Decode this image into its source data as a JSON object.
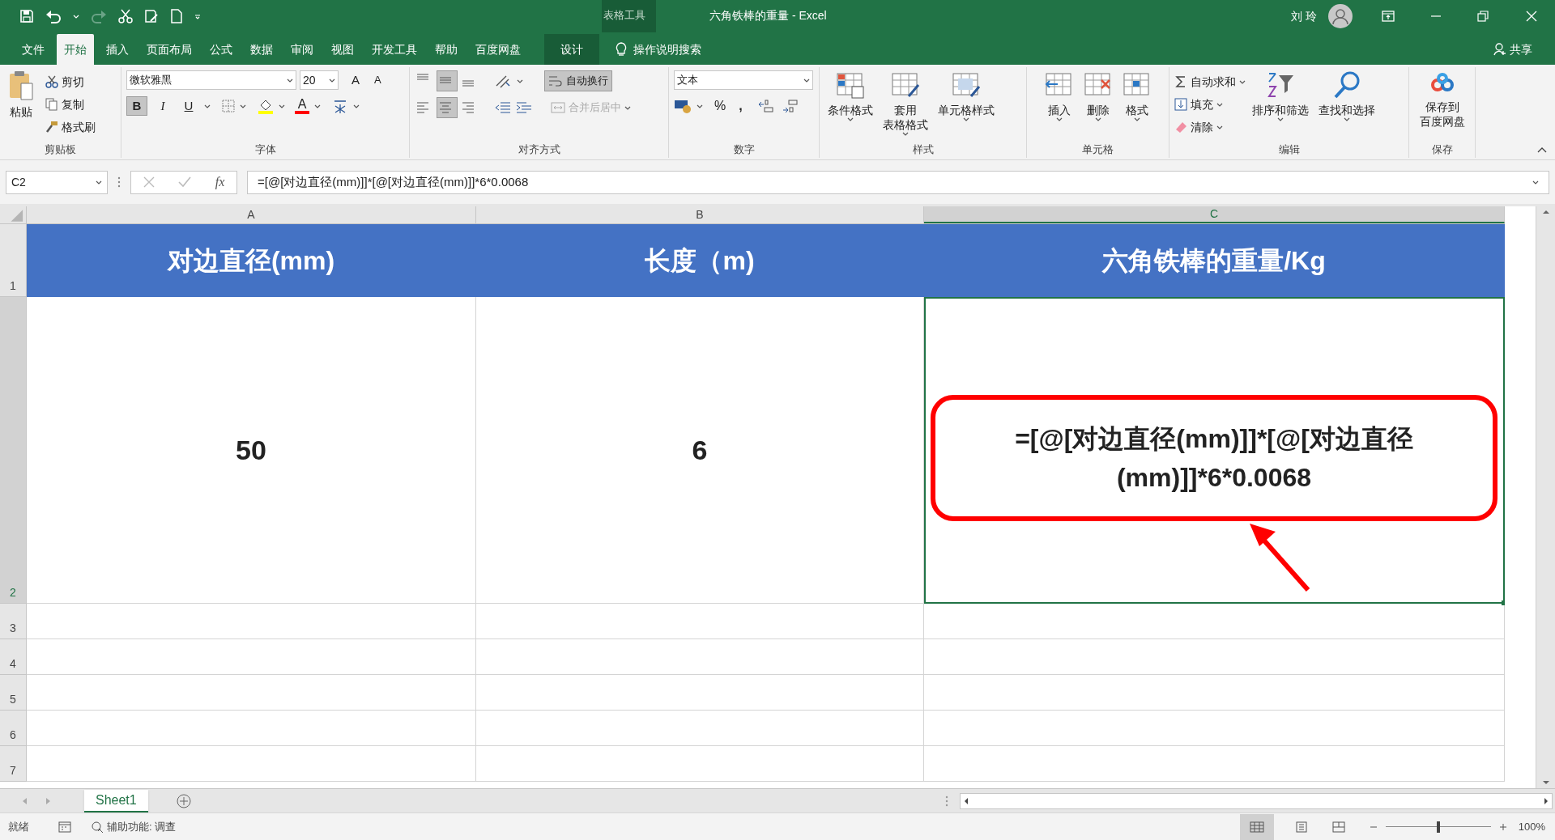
{
  "title_bar": {
    "context_label": "表格工具",
    "title": "六角铁棒的重量  -  Excel",
    "user": "刘 玲"
  },
  "tabs": [
    {
      "label": "文件",
      "selected": false
    },
    {
      "label": "开始",
      "selected": true
    },
    {
      "label": "插入",
      "selected": false
    },
    {
      "label": "页面布局",
      "selected": false
    },
    {
      "label": "公式",
      "selected": false
    },
    {
      "label": "数据",
      "selected": false
    },
    {
      "label": "审阅",
      "selected": false
    },
    {
      "label": "视图",
      "selected": false
    },
    {
      "label": "开发工具",
      "selected": false
    },
    {
      "label": "帮助",
      "selected": false
    },
    {
      "label": "百度网盘",
      "selected": false
    },
    {
      "label": "设计",
      "selected": false,
      "kind": "context"
    }
  ],
  "tell_me": "操作说明搜索",
  "share": "共享",
  "ribbon": [
    {
      "kind": "clipboard",
      "label": "剪贴板",
      "paste": "粘贴",
      "items": [
        "剪切",
        "复制",
        "格式刷"
      ]
    },
    {
      "kind": "font",
      "label": "字体",
      "font": "微软雅黑",
      "size": "20",
      "grow": "A",
      "shrink": "A",
      "toggles": [
        {
          "label": "B",
          "selected": true
        },
        {
          "label": "I",
          "selected": false
        },
        {
          "label": "U",
          "selected": false
        }
      ],
      "font_color": "A"
    },
    {
      "kind": "alignment",
      "label": "对齐方式",
      "vertical": [
        {
          "selected": false
        },
        {
          "selected": true
        },
        {
          "selected": false
        }
      ],
      "horizontal": [
        {
          "selected": false
        },
        {
          "selected": true
        },
        {
          "selected": false
        }
      ],
      "wrap": {
        "label": "自动换行",
        "selected": true
      },
      "merge": {
        "label": "合并后居中",
        "disabled": true
      }
    },
    {
      "kind": "number",
      "label": "数字",
      "format": "文本",
      "percent": "%",
      "comma": ","
    },
    {
      "kind": "styles",
      "label": "样式",
      "items": [
        [
          "条件格式"
        ],
        [
          "套用",
          "表格格式"
        ],
        [
          "单元格样式"
        ]
      ]
    },
    {
      "kind": "cells",
      "label": "单元格",
      "items": [
        "插入",
        "删除",
        "格式"
      ]
    },
    {
      "kind": "editing",
      "label": "编辑",
      "items": [
        "自动求和",
        "填充",
        "清除"
      ],
      "large": [
        "排序和筛选",
        "查找和选择"
      ]
    },
    {
      "kind": "save",
      "label": "保存",
      "items": [
        "保存到",
        "百度网盘"
      ]
    }
  ],
  "formula_bar": {
    "name_box": "C2",
    "function_label": "fx",
    "formula": "=[@[对边直径(mm)]]*[@[对边直径(mm)]]*6*0.0068"
  },
  "sheet": {
    "columns": [
      {
        "label": "A",
        "selected": false
      },
      {
        "label": "B",
        "selected": false
      },
      {
        "label": "C",
        "selected": true
      }
    ],
    "rows": [
      {
        "number": "1",
        "selected": false,
        "cells": [
          "对边直径(mm)",
          "长度（m)",
          "六角铁棒的重量/Kg"
        ]
      },
      {
        "number": "2",
        "selected": true,
        "cells": [
          "50",
          "6",
          "=[@[对边直径(mm)]]*[@[对边直径(mm)]]*6*0.0068"
        ]
      },
      {
        "number": "3",
        "selected": false,
        "cells": []
      },
      {
        "number": "4",
        "selected": false,
        "cells": []
      },
      {
        "number": "5",
        "selected": false,
        "cells": []
      },
      {
        "number": "6",
        "selected": false,
        "cells": []
      },
      {
        "number": "7",
        "selected": false,
        "cells": []
      }
    ]
  },
  "sheet_tabs": [
    {
      "label": "Sheet1",
      "selected": true
    }
  ],
  "status_bar": {
    "ready": "就绪",
    "accessibility": "辅助功能: 调查",
    "zoom": "100%",
    "zoom_slider": {
      "level": 0.5
    }
  }
}
